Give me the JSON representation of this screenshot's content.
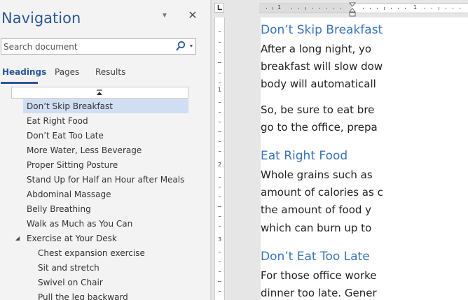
{
  "navigation": {
    "title": "Navigation",
    "search": {
      "placeholder": "Search document",
      "value": ""
    },
    "tabs": [
      {
        "label": "Headings",
        "active": true
      },
      {
        "label": "Pages",
        "active": false
      },
      {
        "label": "Results",
        "active": false
      }
    ],
    "headings": [
      {
        "label": "Don’t Skip Breakfast",
        "level": 1,
        "selected": true
      },
      {
        "label": "Eat Right Food",
        "level": 1
      },
      {
        "label": "Don’t Eat Too Late",
        "level": 1
      },
      {
        "label": "More Water, Less Beverage",
        "level": 1
      },
      {
        "label": "Proper Sitting Posture",
        "level": 1
      },
      {
        "label": "Stand Up for Half an Hour after Meals",
        "level": 1
      },
      {
        "label": "Abdominal Massage",
        "level": 1
      },
      {
        "label": "Belly Breathing",
        "level": 1
      },
      {
        "label": "Walk as Much as You Can",
        "level": 1
      },
      {
        "label": "Exercise at Your Desk",
        "level": 1,
        "expanded": true
      },
      {
        "label": "Chest expansion exercise",
        "level": 2
      },
      {
        "label": "Sit and stretch",
        "level": 2
      },
      {
        "label": "Swivel on Chair",
        "level": 2
      },
      {
        "label": "Pull the leg backward",
        "level": 2
      }
    ]
  },
  "ruler": {
    "horizontal_numbers": [
      "1",
      "1"
    ],
    "vertical_numbers": [
      "1",
      "2",
      "3"
    ]
  },
  "document": {
    "sections": [
      {
        "heading": "Don’t Skip Breakfast",
        "lines": [
          "After a long night, yo",
          "breakfast will slow dow",
          "body will automaticall",
          "",
          "So, be sure to eat bre",
          "go to the office, prepa"
        ]
      },
      {
        "heading": "Eat Right Food",
        "lines": [
          "Whole grains such as",
          "amount of calories as c",
          "the amount of food y",
          "which can burn up to"
        ]
      },
      {
        "heading": "Don’t Eat Too Late",
        "lines": [
          "For those office worke",
          "dinner too late. Gener"
        ]
      }
    ]
  },
  "colors": {
    "accent": "#2b579a",
    "heading_text": "#3a74b8",
    "selection": "#cfdef3"
  }
}
